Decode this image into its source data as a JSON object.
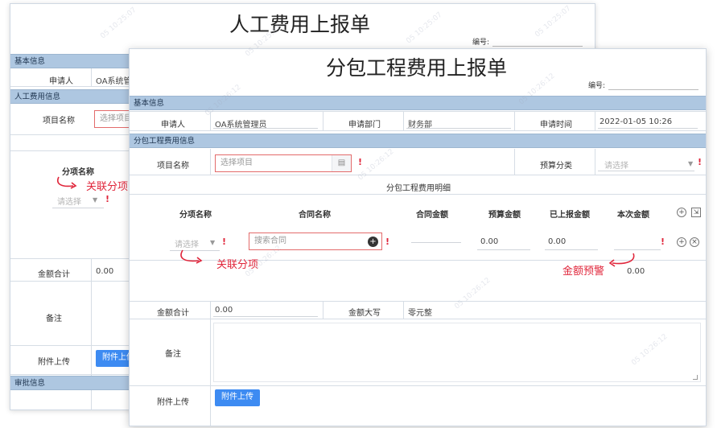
{
  "back_form": {
    "title": "人工费用上报单",
    "serial_label": "编号:",
    "basic_section": "基本信息",
    "applicant_label": "申请人",
    "applicant_value": "OA系统管",
    "labor_section": "人工费用信息",
    "project_label": "项目名称",
    "project_placeholder": "选择项目",
    "item_label": "分项名称",
    "item_placeholder": "请选择",
    "annotation": "关联分项",
    "total_label": "金额合计",
    "total_value": "0.00",
    "remark_label": "备注",
    "attachment_label": "附件上传",
    "upload_button": "附件上传",
    "approval_section": "审批信息"
  },
  "front_form": {
    "title": "分包工程费用上报单",
    "serial_label": "编号:",
    "basic_section": "基本信息",
    "applicant_label": "申请人",
    "applicant_value": "OA系统管理员",
    "dept_label": "申请部门",
    "dept_value": "财务部",
    "time_label": "申请时间",
    "time_value": "2022-01-05 10:26",
    "sub_section": "分包工程费用信息",
    "project_label": "项目名称",
    "project_placeholder": "选择项目",
    "budget_cat_label": "预算分类",
    "budget_cat_placeholder": "请选择",
    "detail_title": "分包工程费用明细",
    "columns": [
      "分项名称",
      "合同名称",
      "合同金额",
      "预算金额",
      "已上报金额",
      "本次金额"
    ],
    "row": {
      "item_placeholder": "请选择",
      "contract_placeholder": "搜索合同",
      "budget_amount": "0.00",
      "reported_amount": "0.00"
    },
    "sum_amount": "0.00",
    "annotation_item": "关联分项",
    "annotation_warning": "金额预警",
    "total_label": "金额合计",
    "total_value": "0.00",
    "capital_label": "金额大写",
    "capital_value": "零元整",
    "remark_label": "备注",
    "attachment_label": "附件上传",
    "upload_button": "附件上传"
  },
  "required_mark": "!",
  "colors": {
    "section_bg": "#aec7e1",
    "accent": "#3d8bf2",
    "required": "#e0263b"
  }
}
